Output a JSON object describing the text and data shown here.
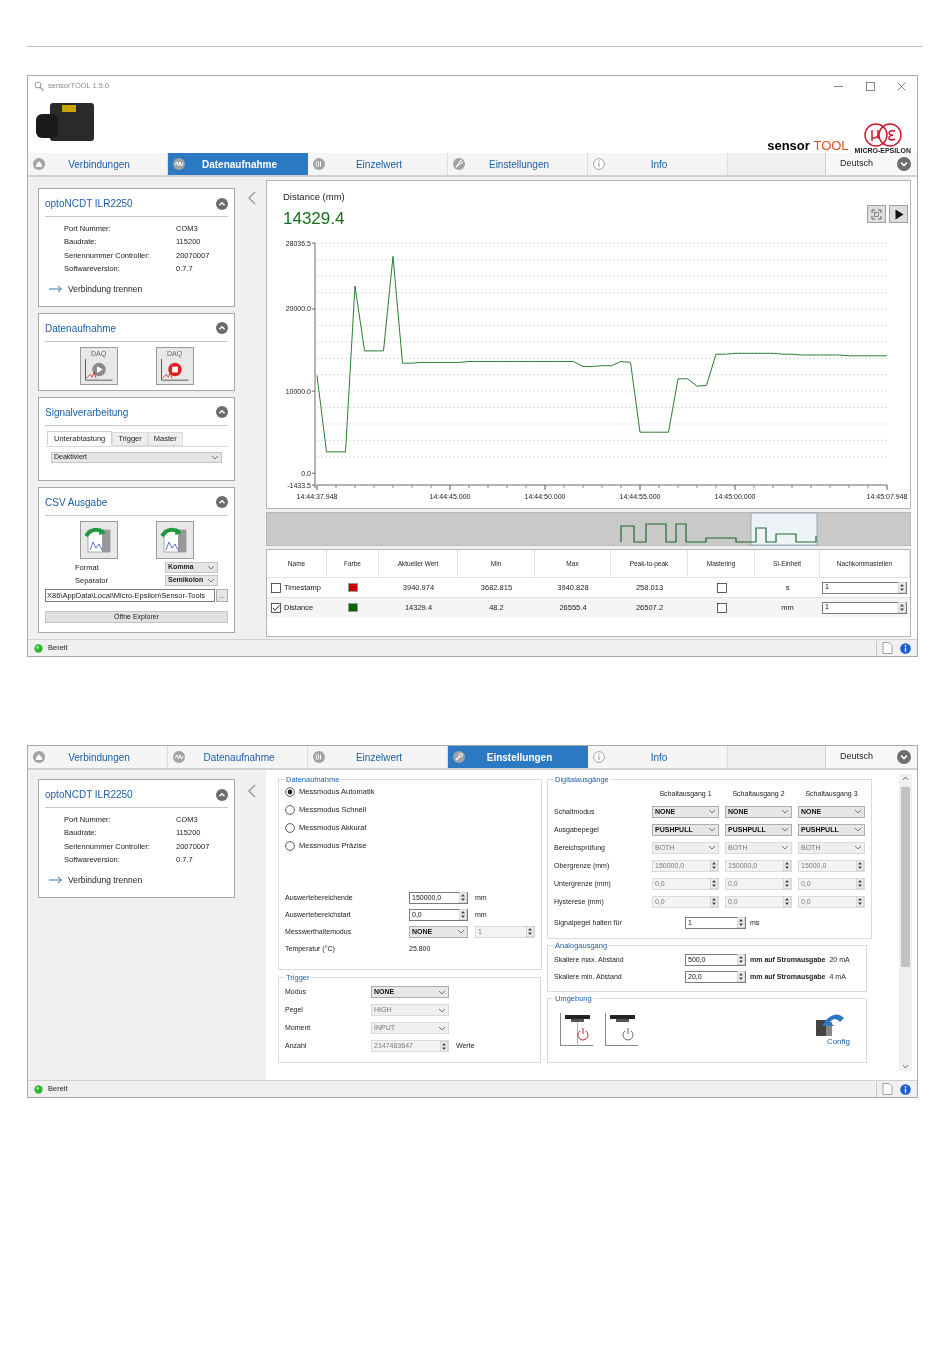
{
  "acquisition_window": {
    "title": "sensorTOOL 1.5.0",
    "brand": {
      "name": "sensor",
      "product": "TOOL",
      "maker": "MICRO-EPSILON"
    },
    "tabs": [
      {
        "label": "Verbindungen",
        "selected": false
      },
      {
        "label": "Datenaufnahme",
        "selected": true
      },
      {
        "label": "Einzelwert",
        "selected": false
      },
      {
        "label": "Einstellungen",
        "selected": false
      },
      {
        "label": "Info",
        "selected": false
      }
    ],
    "language": "Deutsch",
    "device": {
      "title": "optoNCDT ILR2250",
      "info": [
        {
          "label": "Port Nummer:",
          "value": "COM3"
        },
        {
          "label": "Baudrate:",
          "value": "115200"
        },
        {
          "label": "Seriennummer Controller:",
          "value": "20070007"
        },
        {
          "label": "Softwareversion:",
          "value": "0.7.7"
        }
      ],
      "link": "Verbindung trennen"
    },
    "acquisition_panel": {
      "title": "Datenaufnahme",
      "buttons": [
        {
          "kind": "start",
          "label": "DAQ"
        },
        {
          "kind": "stop",
          "label": "DAQ"
        }
      ]
    },
    "signal_panel": {
      "title": "Signalverarbeitung",
      "tabs": [
        {
          "label": "Unterabtastung",
          "selected": true
        },
        {
          "label": "Trigger",
          "selected": false
        },
        {
          "label": "Master",
          "selected": false
        }
      ],
      "select": "Deaktiviert"
    },
    "csv_panel": {
      "title": "CSV Ausgabe",
      "fields": [
        {
          "label": "Format",
          "value": "Komma"
        },
        {
          "label": "Separator",
          "value": "Semikolon"
        }
      ],
      "path": "X86\\AppData\\Local\\Micro-Epsilon\\Sensor-Tools",
      "browse": "...",
      "button": "Öffne Explorer"
    },
    "chart_panel": {
      "title": "Distance (mm)",
      "value": "14329.4",
      "chart_data": {
        "type": "line",
        "ylim": [
          -1433.5,
          28036.5
        ],
        "categories": [
          "14:44:37.948",
          null,
          null,
          null,
          null,
          null,
          null,
          null,
          null,
          null,
          null,
          null,
          null,
          null,
          "14:44:45.000",
          null,
          null,
          null,
          null,
          null,
          null,
          null,
          null,
          null,
          "14:44:50.000",
          null,
          null,
          null,
          null,
          null,
          null,
          null,
          null,
          null,
          "14:44:55.000",
          null,
          null,
          null,
          null,
          null,
          null,
          null,
          null,
          null,
          "14:45:00.000",
          null,
          null,
          null,
          null,
          null,
          null,
          null,
          null,
          null,
          null,
          null,
          null,
          null,
          null,
          null,
          "14:45:07.948"
        ],
        "series": [
          {
            "color": "#2e7d32",
            "values": [
              11900,
              2600,
              2600,
              2600,
              22800,
              14900,
              14900,
              14900,
              26400,
              13400,
              13400,
              13500,
              13500,
              13500,
              13500,
              13500,
              13600,
              13600,
              13600,
              13600,
              13600,
              13600,
              13600,
              13600,
              13600,
              13600,
              13600,
              13600,
              13000,
              13000,
              13100,
              13100,
              13600,
              13500,
              5000,
              5000,
              5000,
              5000,
              11500,
              11500,
              10600,
              10700,
              14500,
              14500,
              14600,
              14600,
              14600,
              14600,
              14600,
              14500,
              14500,
              14400,
              14400,
              14400,
              14400,
              14400,
              14300,
              14300,
              14300,
              14300,
              14300
            ]
          }
        ],
        "yticks": [
          {
            "value": -1433.5,
            "label": "-1433.5"
          },
          {
            "value": 0,
            "label": "0.0"
          },
          {
            "value": 10000,
            "label": "10000.0"
          },
          {
            "value": 20000,
            "label": "20000.0"
          },
          {
            "value": 28036.5,
            "label": "28036.5"
          }
        ]
      }
    },
    "table": {
      "columns": [
        "Name",
        "Farbe",
        "Aktueller Wert",
        "Min",
        "Max",
        "Peak-to-peak",
        "Mastering",
        "SI-Einheit",
        "Nachkommastellen"
      ],
      "rows": [
        {
          "checked": false,
          "name": "Timestamp",
          "color": "#cc0000",
          "current": "3940.974",
          "min": "3682.815",
          "max": "3940.828",
          "peak_to_peak": "258.013",
          "mastering": false,
          "unit": "s",
          "decimals": "1"
        },
        {
          "checked": true,
          "name": "Distance",
          "color": "#006400",
          "current": "14329.4",
          "min": "48.2",
          "max": "26555.4",
          "peak_to_peak": "26507.2",
          "mastering": false,
          "unit": "mm",
          "decimals": "1"
        }
      ]
    },
    "status": "Bereit"
  },
  "settings_window": {
    "tabs": [
      {
        "label": "Verbindungen",
        "selected": false
      },
      {
        "label": "Datenaufnahme",
        "selected": false
      },
      {
        "label": "Einzelwert",
        "selected": false
      },
      {
        "label": "Einstellungen",
        "selected": true
      },
      {
        "label": "Info",
        "selected": false
      }
    ],
    "language": "Deutsch",
    "device": {
      "title": "optoNCDT ILR2250",
      "info": [
        {
          "label": "Port Nummer:",
          "value": "COM3"
        },
        {
          "label": "Baudrate:",
          "value": "115200"
        },
        {
          "label": "Seriennummer Controller:",
          "value": "20070007"
        },
        {
          "label": "Softwareversion:",
          "value": "0.7.7"
        }
      ],
      "link": "Verbindung trennen"
    },
    "measurement": {
      "title": "Datenaufnahme",
      "modes": [
        {
          "label": "Messmodus Automatik",
          "selected": true
        },
        {
          "label": "Messmodus Schnell",
          "selected": false
        },
        {
          "label": "Messmodus Akkurat",
          "selected": false
        },
        {
          "label": "Messmodus Präzise",
          "selected": false
        }
      ],
      "rows": [
        {
          "kind": "spin",
          "label": "Auswertebereichende",
          "value": "150000,0",
          "disabled": false,
          "unit": "mm"
        },
        {
          "kind": "spin",
          "label": "Auswertebereichstart",
          "value": "0,0",
          "disabled": false,
          "unit": "mm"
        },
        {
          "kind": "select_spin",
          "label": "Messwerthaltemodus",
          "value": "NONE",
          "disabled": false,
          "spin": "1",
          "spin_disabled": true
        },
        {
          "kind": "value",
          "label": "Temperatur (°C)",
          "value": "25.800"
        }
      ]
    },
    "trigger": {
      "title": "Trigger",
      "rows": [
        {
          "kind": "select",
          "label": "Modus",
          "value": "NONE",
          "disabled": false
        },
        {
          "kind": "select",
          "label": "Pegel",
          "value": "HIGH",
          "disabled": true
        },
        {
          "kind": "select",
          "label": "Moment",
          "value": "INPUT",
          "disabled": true
        },
        {
          "kind": "spin",
          "label": "Anzahl",
          "value": "2147483647",
          "disabled": true,
          "unit": "Werte"
        }
      ]
    },
    "digital": {
      "title": "Digitalausgänge",
      "columns": [
        "Schaltausgang 1",
        "Schaltausgang 2",
        "Schaltausgang 3"
      ],
      "rows": [
        {
          "kind": "select",
          "label": "Schaltmodus",
          "disabled": false,
          "values": [
            "NONE",
            "NONE",
            "NONE"
          ]
        },
        {
          "kind": "select",
          "label": "Ausgabepegel",
          "disabled": false,
          "values": [
            "PUSHPULL",
            "PUSHPULL",
            "PUSHPULL"
          ]
        },
        {
          "kind": "select",
          "label": "Bereichsprüfung",
          "disabled": true,
          "values": [
            "BOTH",
            "BOTH",
            "BOTH"
          ]
        },
        {
          "kind": "spin",
          "label": "Obergrenze (mm)",
          "disabled": true,
          "values": [
            "150000,0",
            "150000,0",
            "15000,0"
          ]
        },
        {
          "kind": "spin",
          "label": "Untergrenze (mm)",
          "disabled": true,
          "values": [
            "0,0",
            "0,0",
            "0,0"
          ]
        },
        {
          "kind": "spin",
          "label": "Hysterese (mm)",
          "disabled": true,
          "values": [
            "0,0",
            "0,0",
            "0,0"
          ]
        }
      ],
      "hold": {
        "label": "Signalpegel halten für",
        "value": "1",
        "unit": "ms"
      }
    },
    "analog": {
      "title": "Analogausgang",
      "rows": [
        {
          "label": "Skaliere max. Abstand",
          "value": "500,0",
          "unit": "mm auf Stromausgabe",
          "current": "20 mA"
        },
        {
          "label": "Skaliere min. Abstand",
          "value": "20,0",
          "unit": "mm auf Stromausgabe",
          "current": "4 mA"
        }
      ]
    },
    "environment": {
      "title": "Umgebung",
      "buttons": [
        {
          "kind": "laser_on"
        },
        {
          "kind": "laser_off"
        },
        {
          "kind": "config",
          "label": "Config"
        }
      ]
    },
    "status": "Bereit"
  }
}
